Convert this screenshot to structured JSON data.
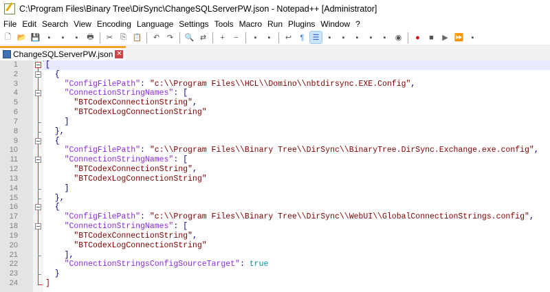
{
  "window": {
    "title": "C:\\Program Files\\Binary Tree\\DirSync\\ChangeSQLServerPW.json - Notepad++ [Administrator]"
  },
  "menu": [
    "File",
    "Edit",
    "Search",
    "View",
    "Encoding",
    "Language",
    "Settings",
    "Tools",
    "Macro",
    "Run",
    "Plugins",
    "Window",
    "?"
  ],
  "toolbar": [
    "new",
    "open",
    "save",
    "save-all",
    "close",
    "close-all",
    "print",
    "|",
    "cut",
    "copy",
    "paste",
    "|",
    "undo",
    "redo",
    "|",
    "find",
    "replace",
    "|",
    "zoom-in",
    "zoom-out",
    "|",
    "sync-v",
    "sync-h",
    "|",
    "word-wrap",
    "show-all-chars",
    "indent-guide",
    "udl",
    "doc-map",
    "doc-list",
    "function-list",
    "folder-workspace",
    "monitor",
    "|",
    "record-macro",
    "stop-record",
    "play-macro",
    "run-macro-multiple",
    "save-macro"
  ],
  "tab": {
    "label": "ChangeSQLServerPW.json"
  },
  "colors": {
    "key": "#8a2be2",
    "string": "#800000",
    "punct": "#000080",
    "bool": "#0a8f8f"
  },
  "lines": [
    {
      "fold": "open-red",
      "t": [
        [
          "p",
          "["
        ]
      ]
    },
    {
      "fold": "open",
      "t": [
        [
          "p",
          "  {"
        ]
      ]
    },
    {
      "fold": "line",
      "t": [
        [
          "k",
          "    \"ConfigFilePath\""
        ],
        [
          "p",
          ": "
        ],
        [
          "s",
          "\"c:\\\\Program Files\\\\HCL\\\\Domino\\\\nbtdirsync.EXE.Config\""
        ],
        [
          "p",
          ","
        ]
      ]
    },
    {
      "fold": "open",
      "t": [
        [
          "k",
          "    \"ConnectionStringNames\""
        ],
        [
          "p",
          ": ["
        ]
      ]
    },
    {
      "fold": "line",
      "t": [
        [
          "s",
          "      \"BTCodexConnectionString\""
        ],
        [
          "p",
          ","
        ]
      ]
    },
    {
      "fold": "line",
      "t": [
        [
          "s",
          "      \"BTCodexLogConnectionString\""
        ]
      ]
    },
    {
      "fold": "tick",
      "t": [
        [
          "p",
          "    ]"
        ]
      ]
    },
    {
      "fold": "tick",
      "t": [
        [
          "p",
          "  },"
        ]
      ]
    },
    {
      "fold": "open",
      "t": [
        [
          "p",
          "  {"
        ]
      ]
    },
    {
      "fold": "line",
      "t": [
        [
          "k",
          "    \"ConfigFilePath\""
        ],
        [
          "p",
          ": "
        ],
        [
          "s",
          "\"c:\\\\Program Files\\\\Binary Tree\\\\DirSync\\\\BinaryTree.DirSync.Exchange.exe.config\""
        ],
        [
          "p",
          ","
        ]
      ]
    },
    {
      "fold": "open",
      "t": [
        [
          "k",
          "    \"ConnectionStringNames\""
        ],
        [
          "p",
          ": ["
        ]
      ]
    },
    {
      "fold": "line",
      "t": [
        [
          "s",
          "      \"BTCodexConnectionString\""
        ],
        [
          "p",
          ","
        ]
      ]
    },
    {
      "fold": "line",
      "t": [
        [
          "s",
          "      \"BTCodexLogConnectionString\""
        ]
      ]
    },
    {
      "fold": "tick",
      "t": [
        [
          "p",
          "    ]"
        ]
      ]
    },
    {
      "fold": "tick",
      "t": [
        [
          "p",
          "  },"
        ]
      ]
    },
    {
      "fold": "open",
      "t": [
        [
          "p",
          "  {"
        ]
      ]
    },
    {
      "fold": "line",
      "t": [
        [
          "k",
          "    \"ConfigFilePath\""
        ],
        [
          "p",
          ": "
        ],
        [
          "s",
          "\"c:\\\\Program Files\\\\Binary Tree\\\\DirSync\\\\WebUI\\\\GlobalConnectionStrings.config\""
        ],
        [
          "p",
          ","
        ]
      ]
    },
    {
      "fold": "open",
      "t": [
        [
          "k",
          "    \"ConnectionStringNames\""
        ],
        [
          "p",
          ": ["
        ]
      ]
    },
    {
      "fold": "line",
      "t": [
        [
          "s",
          "      \"BTCodexConnectionString\""
        ],
        [
          "p",
          ","
        ]
      ]
    },
    {
      "fold": "line",
      "t": [
        [
          "s",
          "      \"BTCodexLogConnectionString\""
        ]
      ]
    },
    {
      "fold": "tick",
      "t": [
        [
          "p",
          "    ],"
        ]
      ]
    },
    {
      "fold": "line",
      "t": [
        [
          "k",
          "    \"ConnectionStringsConfigSourceTarget\""
        ],
        [
          "p",
          ": "
        ],
        [
          "b",
          "true"
        ]
      ]
    },
    {
      "fold": "tick",
      "t": [
        [
          "p",
          "  }"
        ]
      ]
    },
    {
      "fold": "end",
      "t": [
        [
          "s",
          "]"
        ]
      ]
    }
  ]
}
